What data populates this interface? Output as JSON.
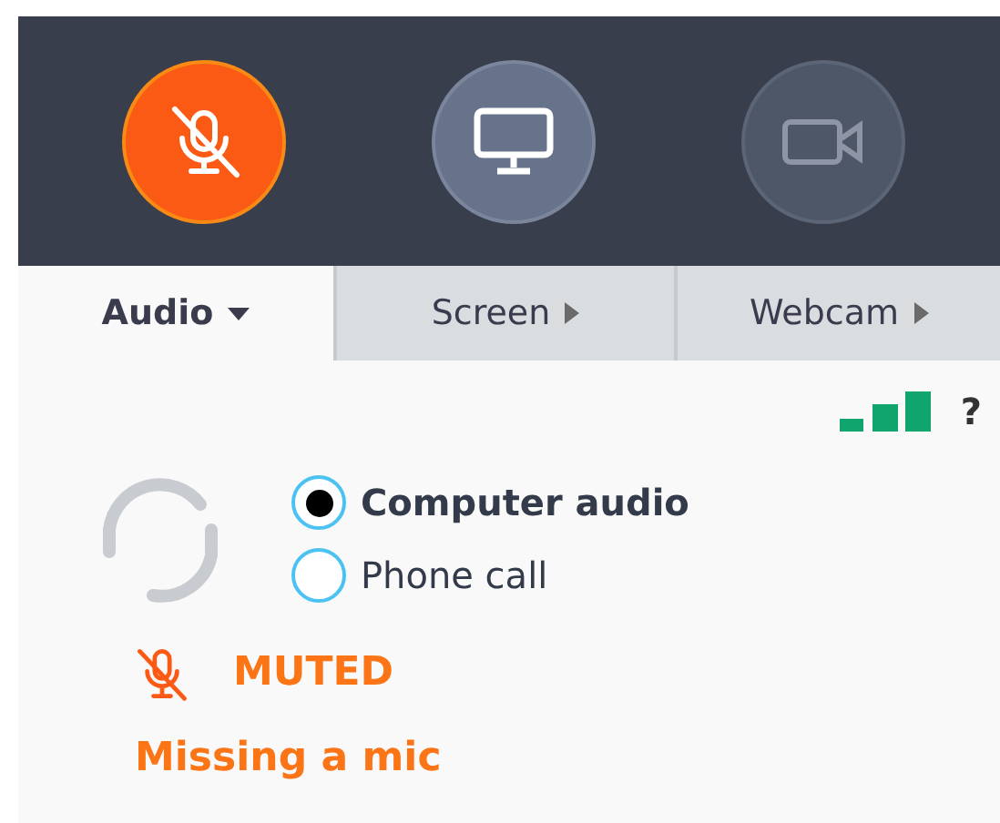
{
  "toolbar": [
    {
      "kind": "mic",
      "muted": true,
      "disabled": false
    },
    {
      "kind": "screen",
      "muted": false,
      "disabled": false
    },
    {
      "kind": "webcam",
      "muted": false,
      "disabled": true
    }
  ],
  "tabs": [
    {
      "label": "Audio",
      "selected": true
    },
    {
      "label": "Screen",
      "selected": false
    },
    {
      "label": "Webcam",
      "selected": false
    }
  ],
  "help": "?",
  "audio_options": [
    {
      "label": "Computer audio",
      "selected": true
    },
    {
      "label": "Phone call",
      "selected": false
    }
  ],
  "status": {
    "muted": true,
    "label": "MUTED",
    "message": "Missing a mic"
  }
}
